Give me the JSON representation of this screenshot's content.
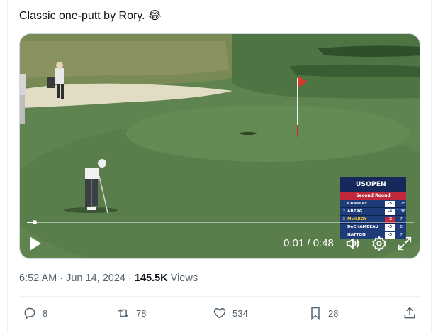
{
  "tweet": {
    "text": "Classic one-putt by Rory. 😂"
  },
  "video": {
    "progress_fraction": 0.02,
    "time_display": "0:01 / 0:48",
    "icons": [
      "play-icon",
      "volume-icon",
      "settings-icon",
      "fullscreen-icon"
    ],
    "scoreboard": {
      "logo_text": "USOPEN",
      "round": "Second Round",
      "rows": [
        {
          "pos": "1",
          "name": "CANTLAY",
          "score": "-5",
          "thru": "1:25",
          "red": false,
          "highlight": false
        },
        {
          "pos": "2",
          "name": "ÅBERG",
          "score": "-4",
          "thru": "1:36",
          "red": false,
          "highlight": false
        },
        {
          "pos": "3",
          "name": "McILROY",
          "score": "-3",
          "thru": "7",
          "red": true,
          "highlight": true
        },
        {
          "pos": "",
          "name": "DeCHAMBEAU",
          "score": "-3",
          "thru": "6",
          "red": false,
          "highlight": false
        },
        {
          "pos": "",
          "name": "HATTON",
          "score": "-3",
          "thru": "7",
          "red": false,
          "highlight": false
        }
      ]
    }
  },
  "meta": {
    "time": "6:52 AM",
    "sep1": "·",
    "date": "Jun 14, 2024",
    "sep2": "·",
    "views_count": "145.5K",
    "views_label": "Views"
  },
  "actions": {
    "replies": "8",
    "reposts": "78",
    "likes": "534",
    "bookmarks": "28"
  },
  "colors": {
    "text_primary": "#0f1419",
    "text_secondary": "#536471",
    "scoreboard_navy": "#16295a",
    "scoreboard_red": "#c1283b",
    "green": "#5f8450"
  }
}
